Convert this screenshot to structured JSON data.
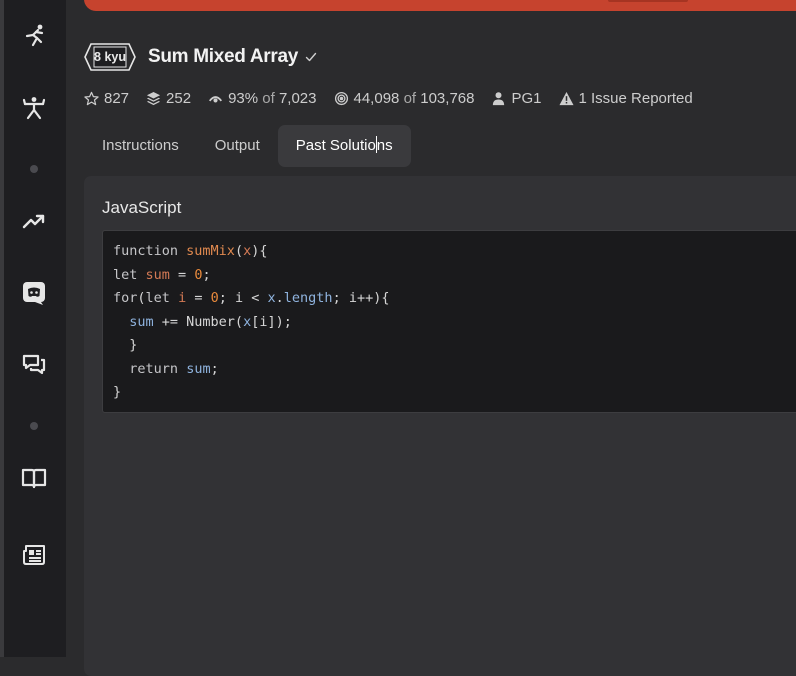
{
  "banner": {
    "color": "#c6432e"
  },
  "sidebar": {
    "items": [
      {
        "icon": "kata-runner-icon"
      },
      {
        "icon": "kumite-fighter-icon"
      },
      {
        "icon": "trending-icon"
      },
      {
        "icon": "discord-icon"
      },
      {
        "icon": "discussion-icon"
      },
      {
        "icon": "docs-book-icon"
      },
      {
        "icon": "news-icon"
      }
    ]
  },
  "kata": {
    "rank": "8 kyu",
    "title": "Sum Mixed Array"
  },
  "stats": {
    "stars": "827",
    "collections": "252",
    "satisfaction": "93%",
    "satisfaction_of": "of",
    "satisfaction_total": "7,023",
    "completed": "44,098",
    "completed_of": "of",
    "completed_total": "103,768",
    "author": "PG1",
    "issues": "1 Issue Reported"
  },
  "tabs": {
    "instructions": "Instructions",
    "output": "Output",
    "past_solutions_a": "Past Solutio",
    "past_solutions_b": "ns"
  },
  "solution": {
    "language": "JavaScript",
    "code_lines": [
      "function sumMix(x){",
      "let sum = 0;",
      "for(let i = 0; i < x.length; i++){",
      "  sum += Number(x[i]);",
      "  }",
      "  return sum;",
      "}"
    ]
  }
}
